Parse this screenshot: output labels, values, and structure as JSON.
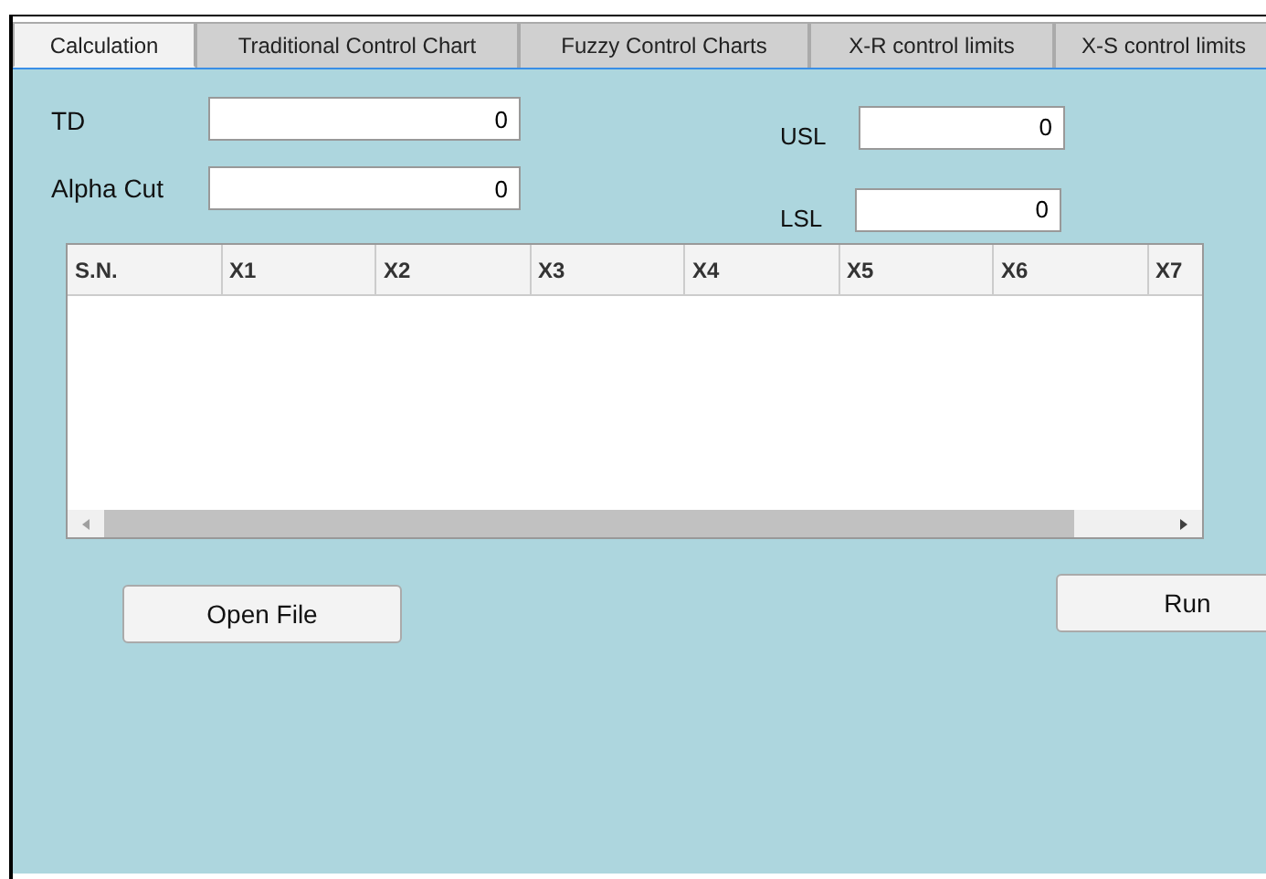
{
  "tabs": [
    {
      "label": "Calculation",
      "selected": true
    },
    {
      "label": "Traditional Control Chart",
      "selected": false
    },
    {
      "label": "Fuzzy Control Charts",
      "selected": false
    },
    {
      "label": "X-R control limits",
      "selected": false
    },
    {
      "label": "X-S control limits",
      "selected": false
    }
  ],
  "fields_left": [
    {
      "label": "TD",
      "value": "0"
    },
    {
      "label": "Alpha Cut",
      "value": "0"
    }
  ],
  "fields_right": [
    {
      "label": "USL",
      "value": "0"
    },
    {
      "label": "LSL",
      "value": "0"
    }
  ],
  "table": {
    "columns": [
      "S.N.",
      "X1",
      "X2",
      "X3",
      "X4",
      "X5",
      "X6",
      "X7"
    ]
  },
  "buttons": [
    "Open File",
    "Run"
  ]
}
